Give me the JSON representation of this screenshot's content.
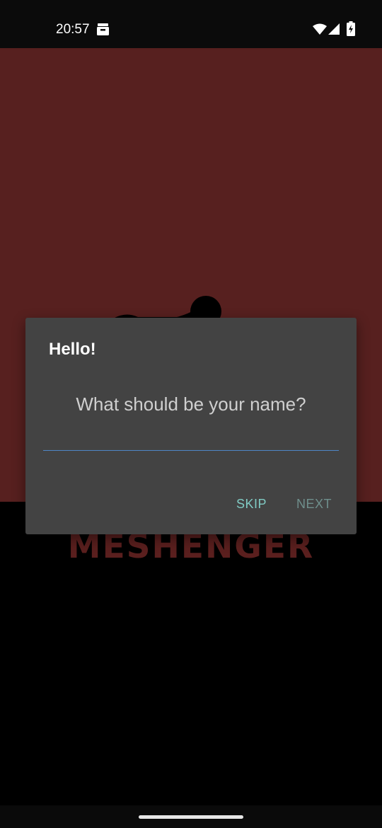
{
  "status_bar": {
    "time": "20:57",
    "icons": [
      "notification-box-icon",
      "wifi-icon",
      "cell-signal-icon",
      "battery-charging-icon"
    ]
  },
  "branding": {
    "word": "MESHENGER",
    "hero_color": "#57201f",
    "word_color": "#5a1f1e"
  },
  "dialog": {
    "title": "Hello!",
    "message": "What should be your name?",
    "name_input": {
      "value": "",
      "placeholder": ""
    },
    "buttons": {
      "skip": "SKIP",
      "next": "NEXT"
    },
    "accent_color": "#80cbc4",
    "underline_color": "#4f86c6",
    "background_color": "#434343"
  }
}
